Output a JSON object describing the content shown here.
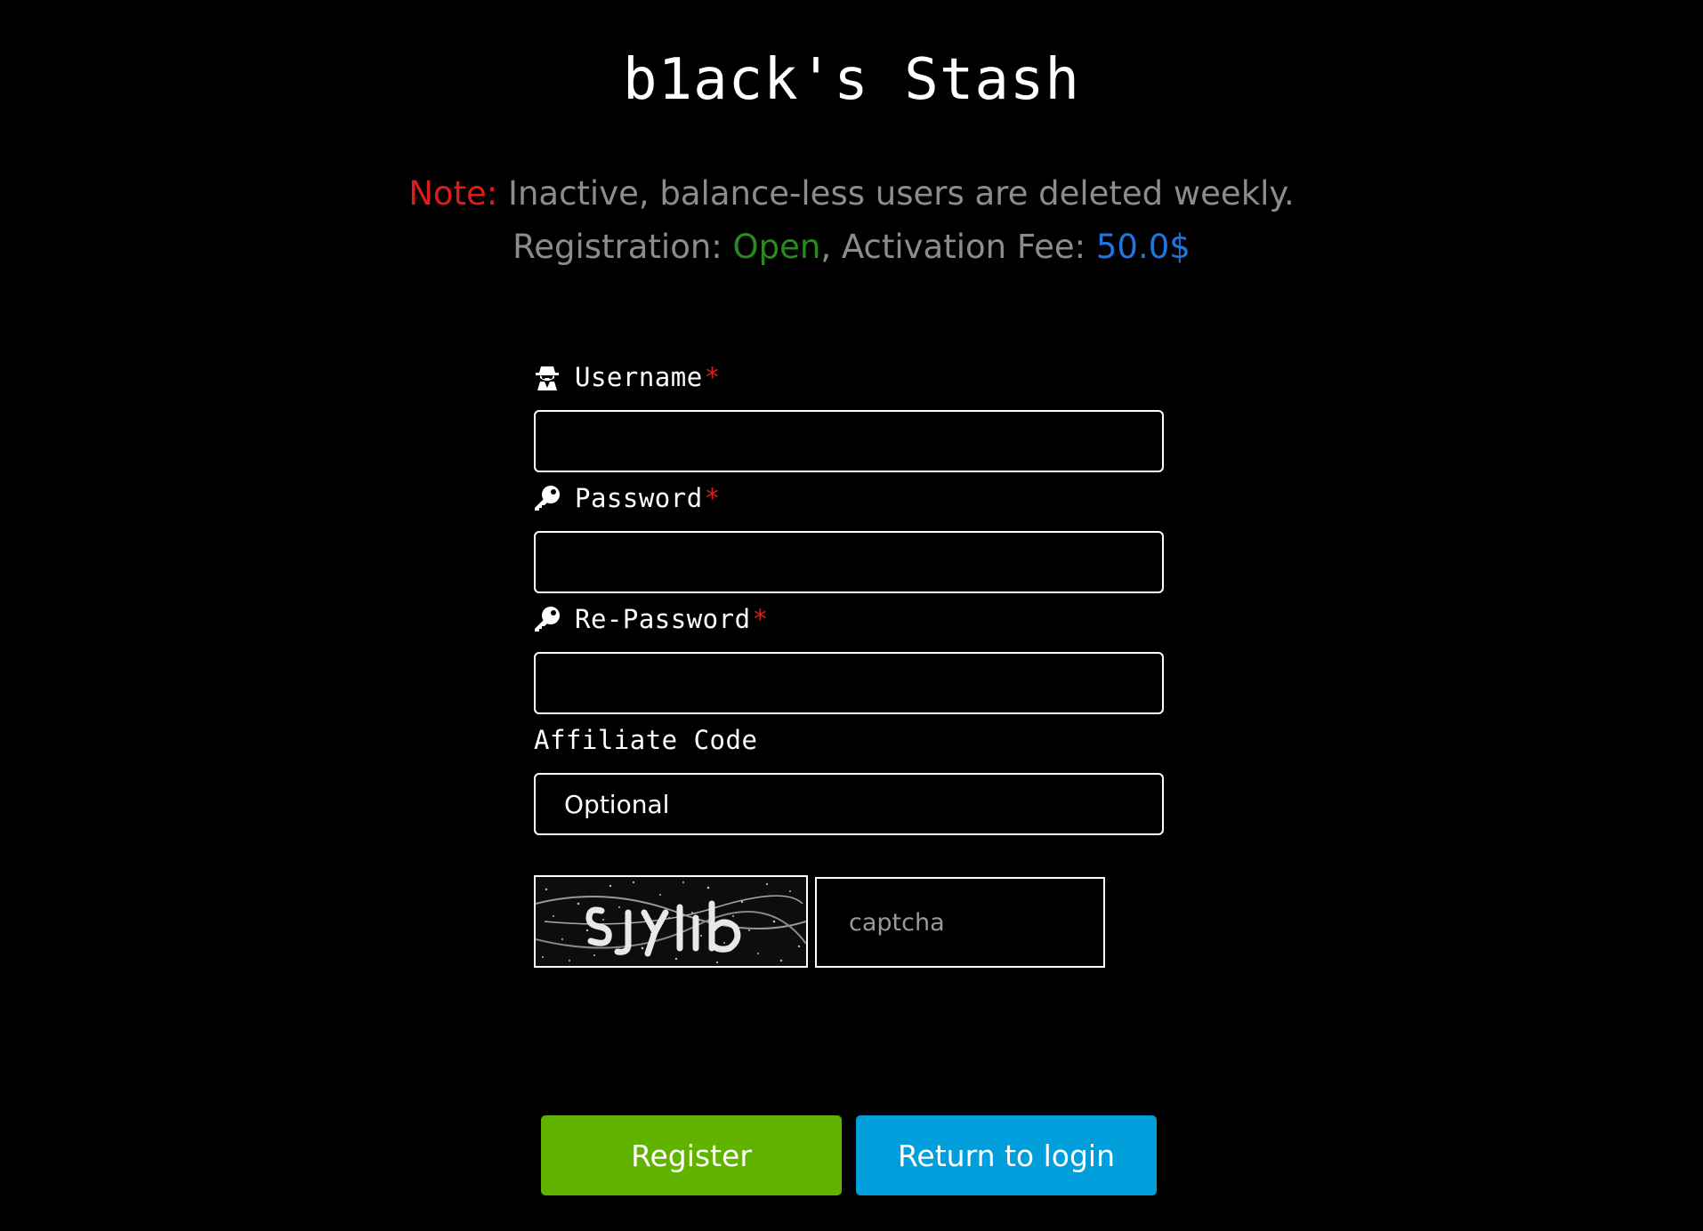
{
  "site": {
    "title": "b1ack's Stash"
  },
  "notice": {
    "note_label": "Note:",
    "note_text": " Inactive, balance-less users are deleted weekly.",
    "registration_label": "Registration: ",
    "registration_status": "Open",
    "fee_label": ", Activation Fee: ",
    "fee_value": "50.0$"
  },
  "colors": {
    "background": "#000000",
    "note": "#e01b1b",
    "open": "#2a8a1f",
    "fee": "#1f76e0",
    "register_button": "#62b300",
    "return_button": "#009edb"
  },
  "form": {
    "username": {
      "label": "Username",
      "required_mark": "*",
      "icon": "spy-icon",
      "value": ""
    },
    "password": {
      "label": "Password",
      "required_mark": "*",
      "icon": "key-icon",
      "value": ""
    },
    "repassword": {
      "label": "Re-Password",
      "required_mark": "*",
      "icon": "key-icon",
      "value": ""
    },
    "affiliate": {
      "label": "Affiliate Code",
      "placeholder": "Optional"
    },
    "captcha": {
      "placeholder": "captcha"
    }
  },
  "buttons": {
    "register": "Register",
    "return_login": "Return to login"
  }
}
